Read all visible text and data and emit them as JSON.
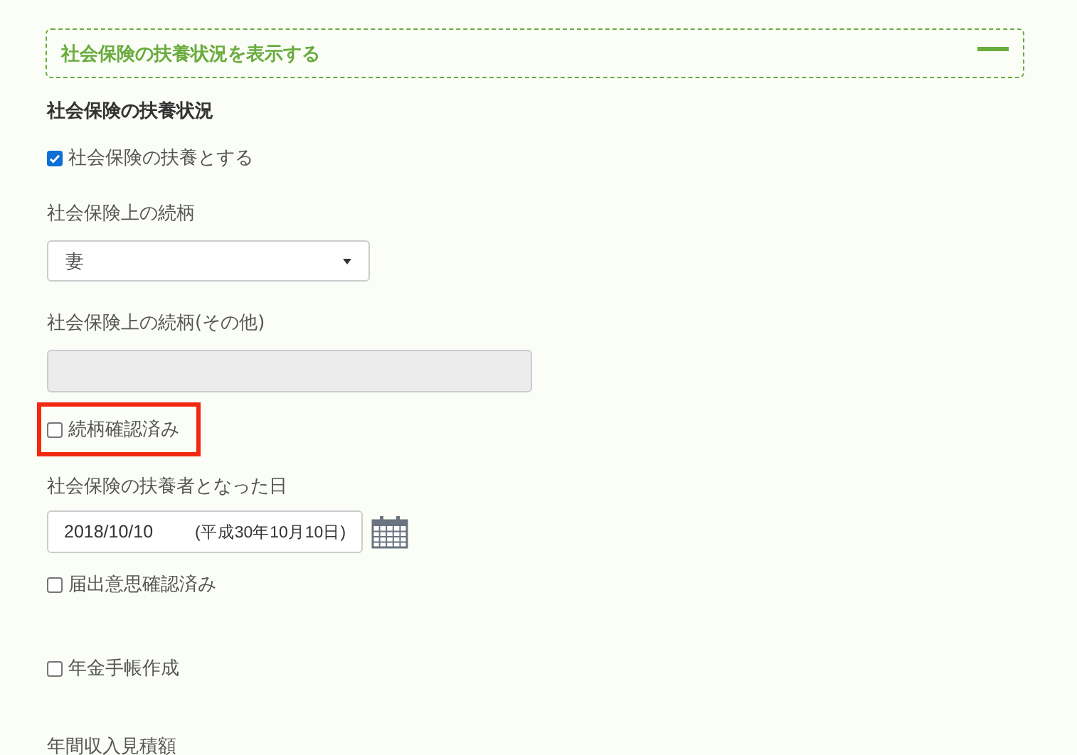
{
  "section_header": {
    "title": "社会保険の扶養状況を表示する",
    "expanded": true
  },
  "heading": "社会保険の扶養状況",
  "fields": [
    {
      "kind": "checkbox",
      "label": "社会保険の扶養とする",
      "checked": true,
      "highlighted": false
    },
    {
      "kind": "select",
      "label": "社会保険上の続柄",
      "value": "妻"
    },
    {
      "kind": "text",
      "label": "社会保険上の続柄(その他)",
      "disabled": true
    },
    {
      "kind": "checkbox",
      "label": "続柄確認済み",
      "checked": false,
      "highlighted": true
    },
    {
      "kind": "date",
      "label": "社会保険の扶養者となった日",
      "value": "2018/10/10",
      "era": "(平成30年10月10日)"
    },
    {
      "kind": "checkbox",
      "label": "届出意思確認済み",
      "checked": false,
      "highlighted": false
    },
    {
      "kind": "checkbox",
      "label": "年金手帳作成",
      "checked": false,
      "highlighted": false
    },
    {
      "kind": "label",
      "label": "年間収入見積額"
    }
  ]
}
